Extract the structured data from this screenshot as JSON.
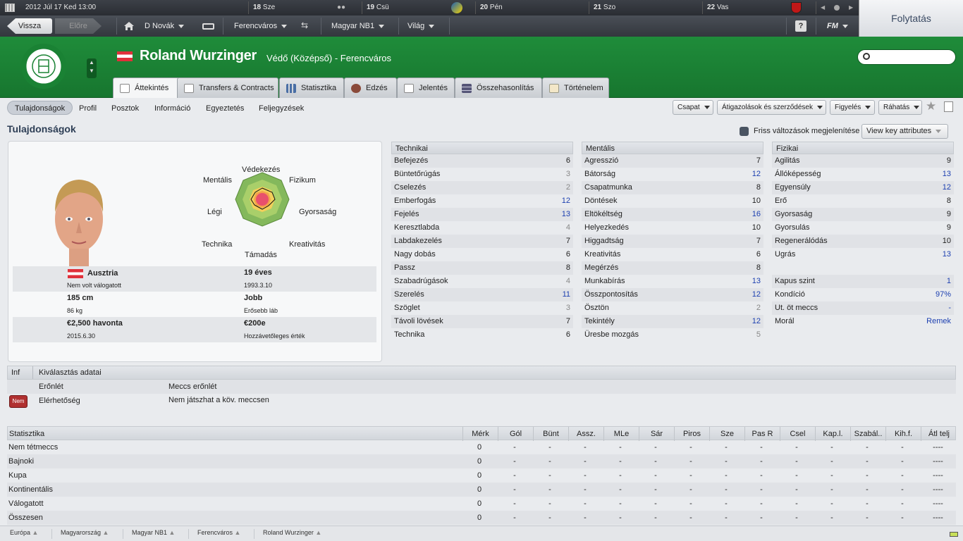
{
  "topbar": {
    "date": "2012 Júl 17  Ked 13:00",
    "days": [
      {
        "num": "18",
        "label": "Sze"
      },
      {
        "num": "19",
        "label": "Csü"
      },
      {
        "num": "20",
        "label": "Pén"
      },
      {
        "num": "21",
        "label": "Szo"
      },
      {
        "num": "22",
        "label": "Vas"
      }
    ],
    "continue": "Folytatás"
  },
  "nav": {
    "back": "Vissza",
    "forward": "Előre",
    "manager": "D Novák",
    "club": "Ferencváros",
    "league": "Magyar NB1",
    "world": "Világ",
    "fm": "FM",
    "help": "?"
  },
  "player": {
    "name": "Roland Wurzinger",
    "subtitle": "Védő (Középső) - Ferencváros"
  },
  "tabs": [
    "Áttekintés",
    "Transfers & Contracts",
    "Statisztika",
    "Edzés",
    "Jelentés",
    "Összehasonlítás",
    "Történelem"
  ],
  "subnav": {
    "items": [
      "Tulajdonságok",
      "Profil",
      "Posztok",
      "Információ",
      "Egyeztetés",
      "Feljegyzések"
    ],
    "dropdowns": [
      "Csapat",
      "Átigazolások és szerződések",
      "Figyelés",
      "Ráhatás"
    ]
  },
  "section_title": "Tulajdonságok",
  "recent_changes": "Friss változások megjelenítése",
  "view_key": "View key attributes",
  "radar_labels": [
    "Védekezés",
    "Fizikum",
    "Gyorsaság",
    "Kreativitás",
    "Támadás",
    "Technika",
    "Légi",
    "Mentális"
  ],
  "bio": [
    {
      "a": "Ausztria",
      "b": "19 éves"
    },
    {
      "a": "Nem volt válogatott",
      "b": "1993.3.10"
    },
    {
      "a": "185 cm",
      "b": "Jobb"
    },
    {
      "a": "86 kg",
      "b": "Erősebb láb"
    },
    {
      "a": "€2,500 havonta",
      "b": "€200e"
    },
    {
      "a": "2015.6.30",
      "b": "Hozzávetőleges érték"
    }
  ],
  "technical": {
    "title": "Technikai",
    "rows": [
      [
        "Befejezés",
        "6"
      ],
      [
        "Büntetőrúgás",
        "3"
      ],
      [
        "Cselezés",
        "2"
      ],
      [
        "Emberfogás",
        "12"
      ],
      [
        "Fejelés",
        "13"
      ],
      [
        "Keresztlabda",
        "4"
      ],
      [
        "Labdakezelés",
        "7"
      ],
      [
        "Nagy dobás",
        "6"
      ],
      [
        "Passz",
        "8"
      ],
      [
        "Szabadrúgások",
        "4"
      ],
      [
        "Szerelés",
        "11"
      ],
      [
        "Szöglet",
        "3"
      ],
      [
        "Távoli lövések",
        "7"
      ],
      [
        "Technika",
        "6"
      ]
    ]
  },
  "mental": {
    "title": "Mentális",
    "rows": [
      [
        "Agresszió",
        "7"
      ],
      [
        "Bátorság",
        "12"
      ],
      [
        "Csapatmunka",
        "8"
      ],
      [
        "Döntések",
        "10"
      ],
      [
        "Eltökéltség",
        "16"
      ],
      [
        "Helyezkedés",
        "10"
      ],
      [
        "Higgadtság",
        "7"
      ],
      [
        "Kreativitás",
        "6"
      ],
      [
        "Megérzés",
        "8"
      ],
      [
        "Munkabírás",
        "13"
      ],
      [
        "Összpontosítás",
        "12"
      ],
      [
        "Ösztön",
        "2"
      ],
      [
        "Tekintély",
        "12"
      ],
      [
        "Üresbe mozgás",
        "5"
      ]
    ]
  },
  "physical": {
    "title": "Fizikai",
    "rows": [
      [
        "Agilitás",
        "9"
      ],
      [
        "Állóképesség",
        "13"
      ],
      [
        "Egyensúly",
        "12"
      ],
      [
        "Erő",
        "8"
      ],
      [
        "Gyorsaság",
        "9"
      ],
      [
        "Gyorsulás",
        "9"
      ],
      [
        "Regenerálódás",
        "10"
      ],
      [
        "Ugrás",
        "13"
      ]
    ]
  },
  "condition": [
    [
      "Kapus szint",
      "1"
    ],
    [
      "Kondíció",
      "97%"
    ],
    [
      "Ut. öt meccs",
      "-"
    ],
    [
      "Morál",
      "Remek"
    ]
  ],
  "selection": {
    "inf": "Inf",
    "title": "Kiválasztás adatai",
    "rows": [
      {
        "badge": "",
        "label": "Erőnlét",
        "value": "Meccs erőnlét"
      },
      {
        "badge": "Nem",
        "label": "Elérhetőség",
        "value": "Nem játszhat a köv. meccsen"
      }
    ]
  },
  "stats": {
    "header": [
      "Statisztika",
      "Mérk",
      "Gól",
      "Bünt",
      "Assz.",
      "MLe",
      "Sár",
      "Piros",
      "Sze",
      "Pas R",
      "Csel",
      "Kap.l.",
      "Szabál..",
      "Kih.f.",
      "Átl telj"
    ],
    "rows": [
      [
        "Nem tétmeccs",
        "0",
        "-",
        "-",
        "-",
        "-",
        "-",
        "-",
        "-",
        "-",
        "-",
        "-",
        "-",
        "-",
        "----"
      ],
      [
        "Bajnoki",
        "0",
        "-",
        "-",
        "-",
        "-",
        "-",
        "-",
        "-",
        "-",
        "-",
        "-",
        "-",
        "-",
        "----"
      ],
      [
        "Kupa",
        "0",
        "-",
        "-",
        "-",
        "-",
        "-",
        "-",
        "-",
        "-",
        "-",
        "-",
        "-",
        "-",
        "----"
      ],
      [
        "Kontinentális",
        "0",
        "-",
        "-",
        "-",
        "-",
        "-",
        "-",
        "-",
        "-",
        "-",
        "-",
        "-",
        "-",
        "----"
      ],
      [
        "Válogatott",
        "0",
        "-",
        "-",
        "-",
        "-",
        "-",
        "-",
        "-",
        "-",
        "-",
        "-",
        "-",
        "-",
        "----"
      ],
      [
        "Összesen",
        "0",
        "-",
        "-",
        "-",
        "-",
        "-",
        "-",
        "-",
        "-",
        "-",
        "-",
        "-",
        "-",
        "----"
      ]
    ]
  },
  "breadcrumbs": [
    "Európa",
    "Magyarország",
    "Magyar NB1",
    "Ferencváros",
    "Roland Wurzinger"
  ],
  "colors": {
    "green": "#1a8234",
    "highlight": "#1c3fb0",
    "badge_red": "#c0392b"
  }
}
